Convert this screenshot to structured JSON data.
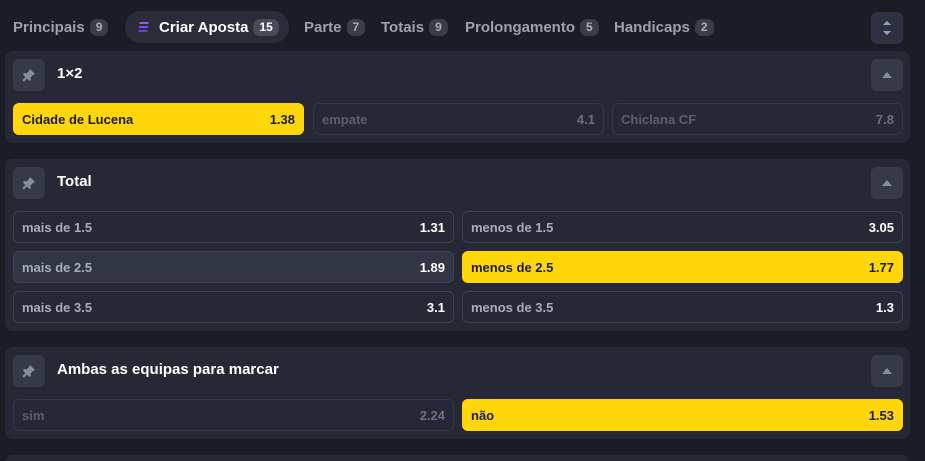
{
  "tabs": [
    {
      "label": "Principais",
      "count": "9"
    },
    {
      "label": "Criar Aposta",
      "count": "15"
    },
    {
      "label": "Parte",
      "count": "7"
    },
    {
      "label": "Totais",
      "count": "9"
    },
    {
      "label": "Prolongamento",
      "count": "5"
    },
    {
      "label": "Handicaps",
      "count": "2"
    }
  ],
  "colors": {
    "accent": "#ffd60a",
    "brand_icon": "#8b5cf6",
    "background": "#1b1d26",
    "card": "#262935"
  },
  "markets": [
    {
      "title": "1×2",
      "outcomes": [
        {
          "label": "Cidade de Lucena",
          "value": "1.38",
          "state": "selected"
        },
        {
          "label": "empate",
          "value": "4.1",
          "state": "disabled"
        },
        {
          "label": "Chiclana CF",
          "value": "7.8",
          "state": "disabled"
        }
      ]
    },
    {
      "title": "Total",
      "outcomes": [
        {
          "label": "mais de 1.5",
          "value": "1.31",
          "state": "normal"
        },
        {
          "label": "menos de 1.5",
          "value": "3.05",
          "state": "normal"
        },
        {
          "label": "mais de 2.5",
          "value": "1.89",
          "state": "normal"
        },
        {
          "label": "menos de 2.5",
          "value": "1.77",
          "state": "selected"
        },
        {
          "label": "mais de 3.5",
          "value": "3.1",
          "state": "normal"
        },
        {
          "label": "menos de 3.5",
          "value": "1.3",
          "state": "normal"
        }
      ]
    },
    {
      "title": "Ambas as equipas para marcar",
      "outcomes": [
        {
          "label": "sim",
          "value": "2.24",
          "state": "disabled"
        },
        {
          "label": "não",
          "value": "1.53",
          "state": "selected"
        }
      ]
    }
  ],
  "icons": {
    "tab_bet_builder": "bet-builder-icon",
    "pin": "pin-icon",
    "caret": "chevron-up-icon",
    "collapse_all": "collapse-all-icon"
  }
}
